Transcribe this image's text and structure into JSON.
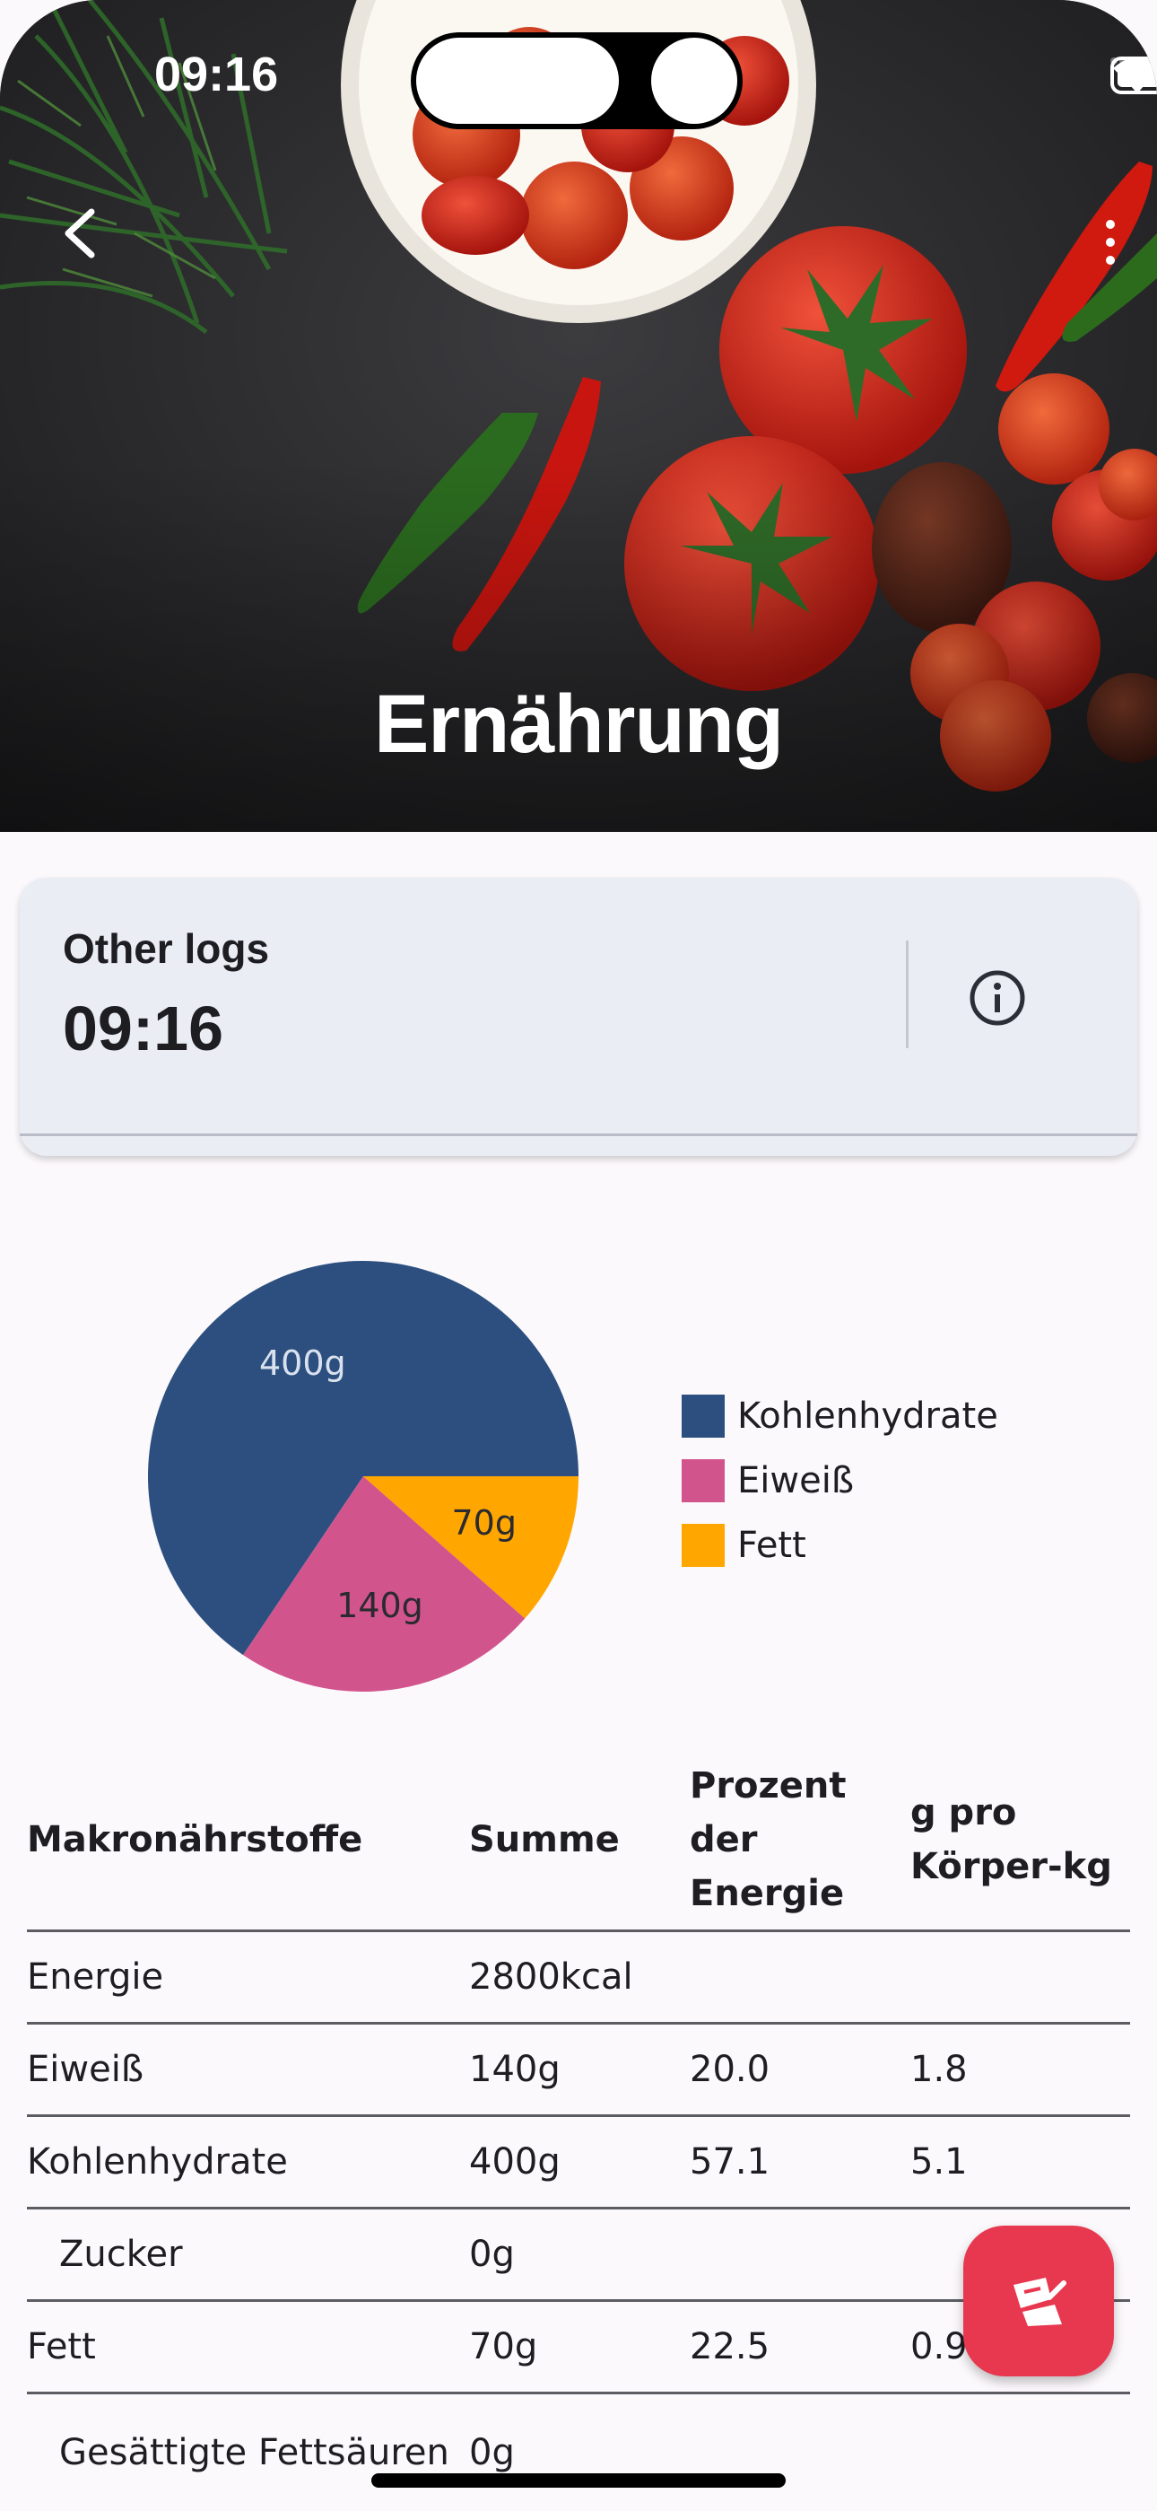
{
  "status_bar": {
    "time": "09:16"
  },
  "header": {
    "title": "Ernährung"
  },
  "log_card": {
    "subtitle": "Other logs",
    "time": "09:16"
  },
  "chart_data": {
    "type": "pie",
    "slices": [
      {
        "name": "Kohlenhydrate",
        "value": 400,
        "label": "400g",
        "color": "#2c4f7f"
      },
      {
        "name": "Eiweiß",
        "value": 140,
        "label": "140g",
        "color": "#d2548d"
      },
      {
        "name": "Fett",
        "value": 70,
        "label": "70g",
        "color": "#ffa600"
      }
    ],
    "legend": [
      "Kohlenhydrate",
      "Eiweiß",
      "Fett"
    ],
    "legend_position": "right"
  },
  "table": {
    "headers": [
      "Makronährstoffe",
      "Summe",
      "Prozent der Energie",
      "g pro Körper-kg"
    ],
    "rows": [
      {
        "name": "Energie",
        "sum": "2800kcal",
        "percent": "",
        "per_kg": ""
      },
      {
        "name": "Eiweiß",
        "sum": "140g",
        "percent": "20.0",
        "per_kg": "1.8"
      },
      {
        "name": "Kohlenhydrate",
        "sum": "400g",
        "percent": "57.1",
        "per_kg": "5.1"
      },
      {
        "name": "Zucker",
        "sum": "0g",
        "percent": "",
        "per_kg": ""
      },
      {
        "name": "Fett",
        "sum": "70g",
        "percent": "22.5",
        "per_kg": "0.9"
      },
      {
        "name": "Gesättigte Fettsäuren",
        "sum": "0g",
        "percent": "",
        "per_kg": ""
      }
    ]
  },
  "colors": {
    "accent": "#e8384f",
    "card_bg": "#eaedf4"
  },
  "icons": {
    "back": "chevron-left-icon",
    "more": "more-vert-icon",
    "info": "info-icon",
    "fab": "food-log-icon"
  }
}
